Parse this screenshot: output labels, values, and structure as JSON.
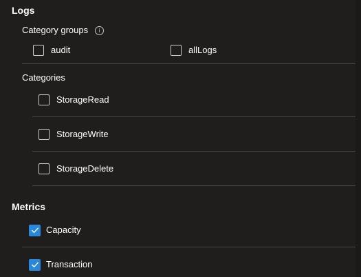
{
  "logs": {
    "title": "Logs",
    "category_groups": {
      "label": "Category groups",
      "info_icon": "info-icon",
      "items": [
        {
          "label": "audit",
          "checked": false
        },
        {
          "label": "allLogs",
          "checked": false
        }
      ]
    },
    "categories": {
      "label": "Categories",
      "items": [
        {
          "label": "StorageRead",
          "checked": false
        },
        {
          "label": "StorageWrite",
          "checked": false
        },
        {
          "label": "StorageDelete",
          "checked": false
        }
      ]
    }
  },
  "metrics": {
    "title": "Metrics",
    "items": [
      {
        "label": "Capacity",
        "checked": true
      },
      {
        "label": "Transaction",
        "checked": true
      }
    ]
  },
  "colors": {
    "background": "#1f1e1d",
    "checked_accent": "#2b88d8",
    "divider": "#4a4847"
  }
}
